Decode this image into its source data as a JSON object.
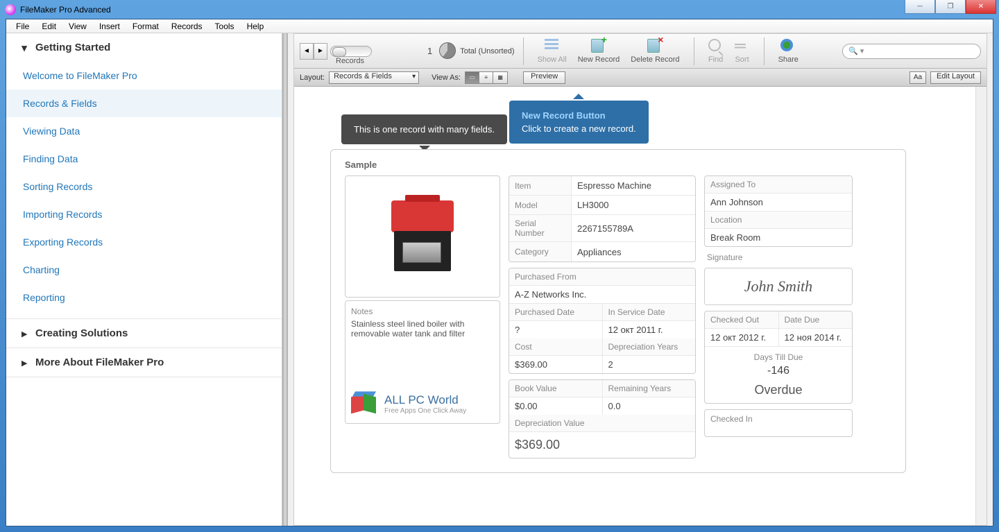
{
  "window": {
    "title": "FileMaker Pro Advanced"
  },
  "menu": [
    "File",
    "Edit",
    "View",
    "Insert",
    "Format",
    "Records",
    "Tools",
    "Help"
  ],
  "sidebar": {
    "sec1": {
      "title": "Getting Started",
      "items": [
        "Welcome to FileMaker Pro",
        "Records & Fields",
        "Viewing Data",
        "Finding Data",
        "Sorting Records",
        "Importing Records",
        "Exporting Records",
        "Charting",
        "Reporting"
      ]
    },
    "sec2": {
      "title": "Creating Solutions"
    },
    "sec3": {
      "title": "More About FileMaker Pro"
    }
  },
  "toolbar": {
    "records_lbl": "Records",
    "count": "1",
    "total_lbl": "Total (Unsorted)",
    "showall": "Show All",
    "newrec": "New Record",
    "delrec": "Delete Record",
    "find": "Find",
    "sort": "Sort",
    "share": "Share",
    "search_ph": "🔍 ▾"
  },
  "layoutbar": {
    "layout_lbl": "Layout:",
    "layout_val": "Records & Fields",
    "viewas_lbl": "View As:",
    "preview": "Preview",
    "aa": "Aa",
    "edit": "Edit Layout"
  },
  "tooltips": {
    "dark": "This is one record with many fields.",
    "blue_title": "New Record Button",
    "blue_body": "Click to create a new record."
  },
  "record": {
    "heading": "Sample",
    "item_lbl": "Item",
    "item": "Espresso Machine",
    "model_lbl": "Model",
    "model": "LH3000",
    "serial_lbl": "Serial Number",
    "serial": "2267155789A",
    "cat_lbl": "Category",
    "cat": "Appliances",
    "pf_lbl": "Purchased From",
    "pf": "A-Z Networks Inc.",
    "pd_lbl": "Purchased Date",
    "pd": "?",
    "isd_lbl": "In Service Date",
    "isd": "12 окт 2011 г.",
    "cost_lbl": "Cost",
    "cost": "$369.00",
    "dy_lbl": "Depreciation Years",
    "dy": "2",
    "bv_lbl": "Book Value",
    "bv": "$0.00",
    "ry_lbl": "Remaining Years",
    "ry": "0.0",
    "dv_lbl": "Depreciation Value",
    "dv": "$369.00",
    "notes_lbl": "Notes",
    "notes": "Stainless steel lined boiler with removable water tank and filter",
    "assigned_lbl": "Assigned To",
    "assigned": "Ann Johnson",
    "loc_lbl": "Location",
    "loc": "Break Room",
    "sig_lbl": "Signature",
    "sig": "John Smith",
    "co_lbl": "Checked Out",
    "co": "12 окт 2012 г.",
    "dd_lbl": "Date Due",
    "dd": "12 ноя 2014 г.",
    "dtd_lbl": "Days Till Due",
    "dtd": "-146",
    "status": "Overdue",
    "ci_lbl": "Checked In"
  },
  "watermark": {
    "title": "ALL PC World",
    "sub": "Free Apps One Click Away"
  }
}
